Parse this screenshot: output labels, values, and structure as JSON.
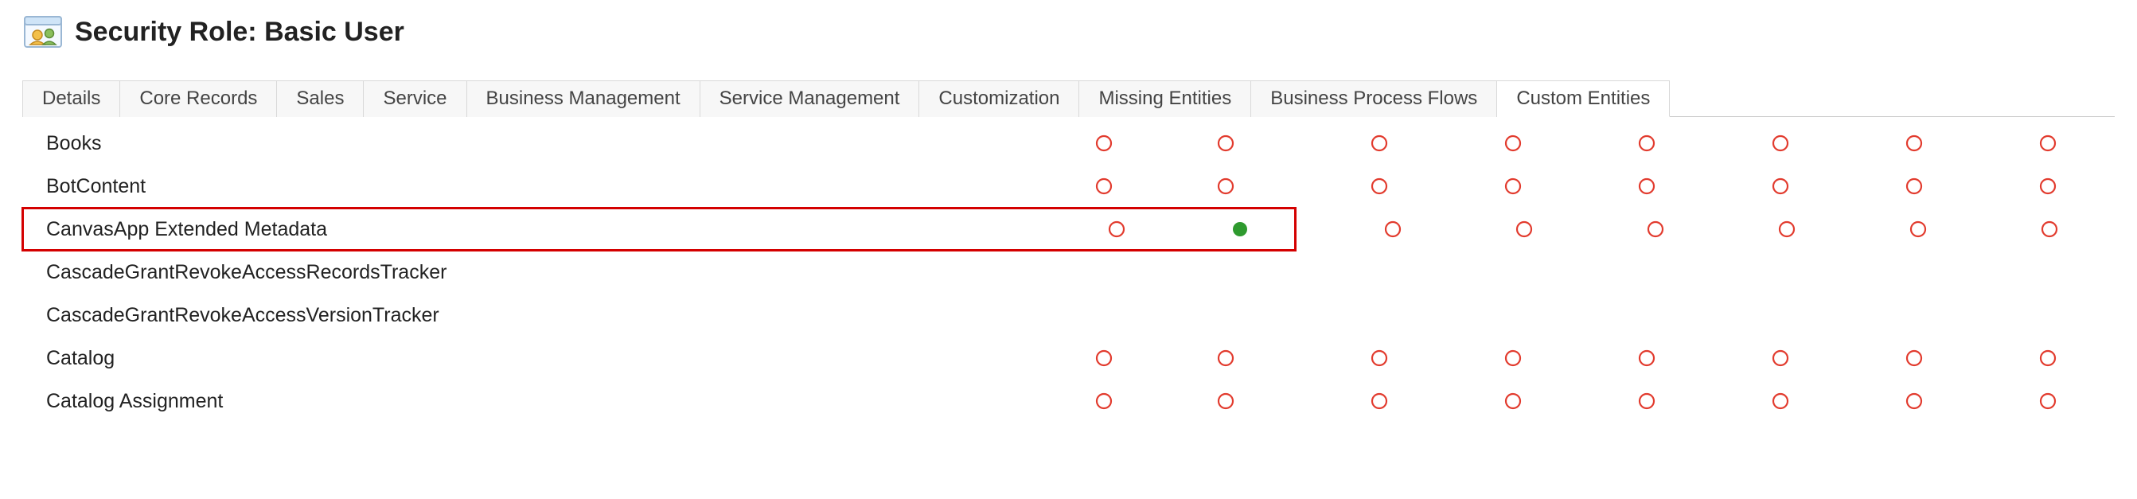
{
  "header": {
    "title": "Security Role: Basic User"
  },
  "tabs": [
    {
      "label": "Details"
    },
    {
      "label": "Core Records"
    },
    {
      "label": "Sales"
    },
    {
      "label": "Service"
    },
    {
      "label": "Business Management"
    },
    {
      "label": "Service Management"
    },
    {
      "label": "Customization"
    },
    {
      "label": "Missing Entities"
    },
    {
      "label": "Business Process Flows"
    },
    {
      "label": "Custom Entities",
      "active": true
    }
  ],
  "privilegeColumns": 8,
  "colors": {
    "none": "#e23b2e",
    "full": "#2e9a2e",
    "highlight": "#d40000"
  },
  "entities": [
    {
      "name": "Books",
      "privileges": [
        "none",
        "none",
        "none",
        "none",
        "none",
        "none",
        "none",
        "none"
      ]
    },
    {
      "name": "BotContent",
      "privileges": [
        "none",
        "none",
        "none",
        "none",
        "none",
        "none",
        "none",
        "none"
      ]
    },
    {
      "name": "CanvasApp Extended Metadata",
      "highlighted": true,
      "privileges": [
        "none",
        "full",
        "none",
        "none",
        "none",
        "none",
        "none",
        "none"
      ]
    },
    {
      "name": "CascadeGrantRevokeAccessRecordsTracker",
      "privileges": []
    },
    {
      "name": "CascadeGrantRevokeAccessVersionTracker",
      "privileges": []
    },
    {
      "name": "Catalog",
      "privileges": [
        "none",
        "none",
        "none",
        "none",
        "none",
        "none",
        "none",
        "none"
      ]
    },
    {
      "name": "Catalog Assignment",
      "privileges": [
        "none",
        "none",
        "none",
        "none",
        "none",
        "none",
        "none",
        "none"
      ]
    }
  ]
}
